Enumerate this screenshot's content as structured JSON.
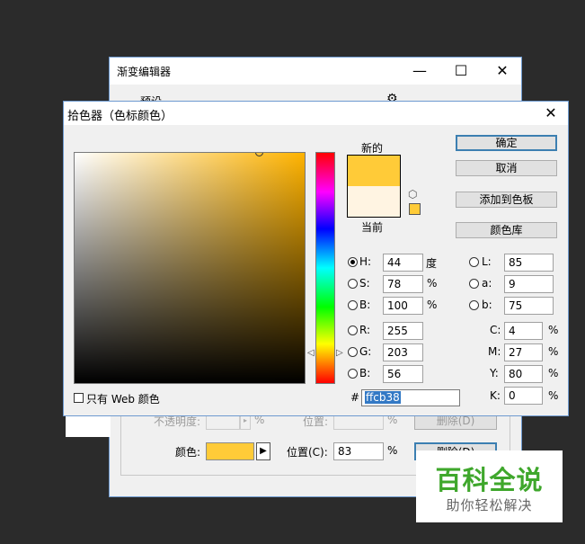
{
  "gradient_editor": {
    "title": "渐变编辑器",
    "minimize": "—",
    "maximize": "☐",
    "close": "✕",
    "presets_label": "预设",
    "gear_icon": "gear-icon",
    "opacity_label": "不透明度:",
    "opacity_unit": "%",
    "position_label_dim": "位置:",
    "position_unit_dim": "%",
    "delete_label_dim": "删除(D)",
    "color_label": "颜色:",
    "color_swatch": "#ffcb38",
    "position_label": "位置(C):",
    "position_value": "83",
    "position_unit": "%",
    "delete_label": "删除(D)"
  },
  "color_picker": {
    "title": "拾色器（色标颜色）",
    "close": "✕",
    "new_label": "新的",
    "current_label": "当前",
    "new_color": "#ffcb38",
    "current_color": "#fff4e2",
    "buttons": {
      "ok": "确定",
      "cancel": "取消",
      "add_to_swatches": "添加到色板",
      "color_libraries": "颜色库"
    },
    "hsb": {
      "h_label": "H:",
      "h_value": "44",
      "h_unit": "度",
      "s_label": "S:",
      "s_value": "78",
      "s_unit": "%",
      "b_label": "B:",
      "b_value": "100",
      "b_unit": "%"
    },
    "rgb": {
      "r_label": "R:",
      "r_value": "255",
      "g_label": "G:",
      "g_value": "203",
      "b_label": "B:",
      "b_value": "56"
    },
    "lab": {
      "l_label": "L:",
      "l_value": "85",
      "a_label": "a:",
      "a_value": "9",
      "b_label": "b:",
      "b_value": "75"
    },
    "cmyk": {
      "c_label": "C:",
      "c_value": "4",
      "c_unit": "%",
      "m_label": "M:",
      "m_value": "27",
      "m_unit": "%",
      "y_label": "Y:",
      "y_value": "80",
      "y_unit": "%",
      "k_label": "K:",
      "k_value": "0",
      "k_unit": "%"
    },
    "web_only_label": "只有 Web 颜色",
    "hex_prefix": "#",
    "hex_value": "ffcb38"
  },
  "watermark": {
    "title": "百科全说",
    "subtitle": "助你轻松解决"
  }
}
